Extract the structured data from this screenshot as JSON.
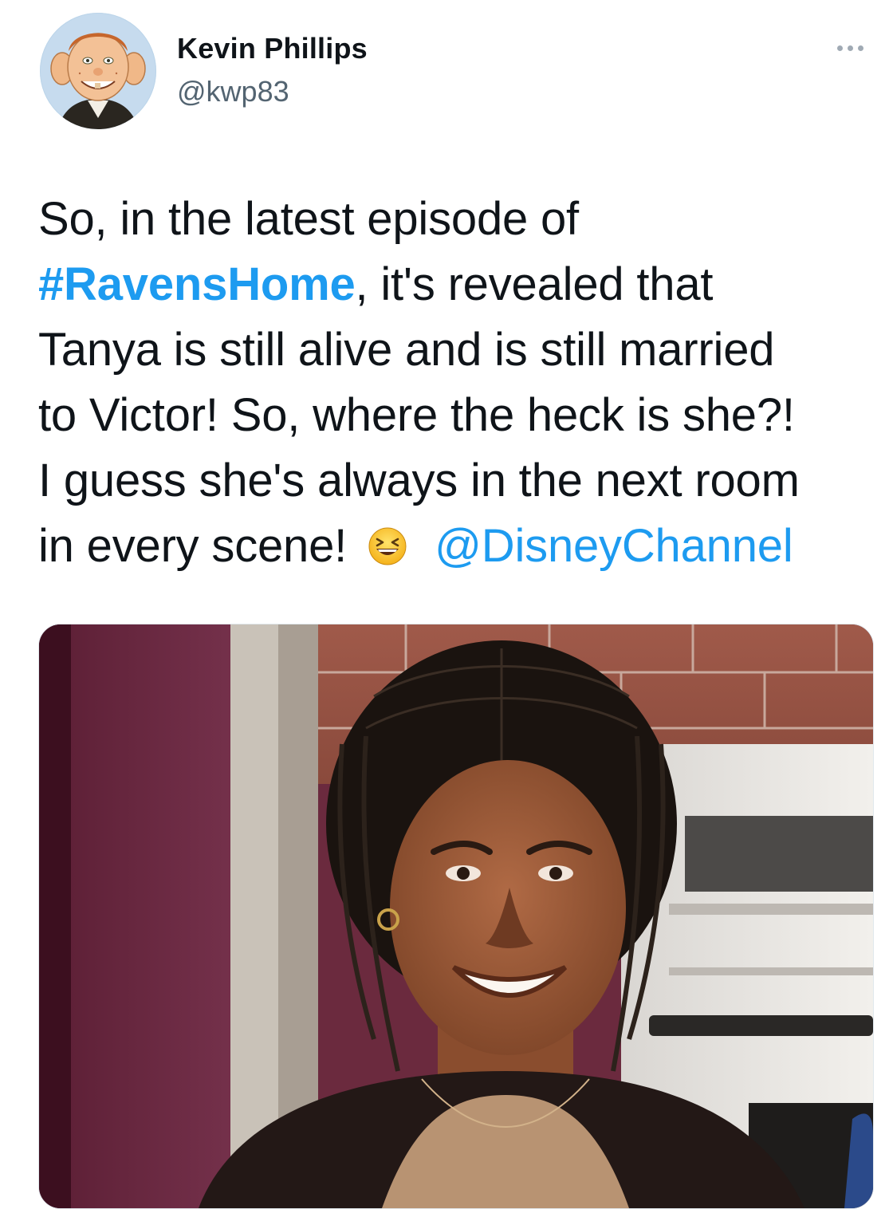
{
  "author": {
    "display_name": "Kevin Phillips",
    "handle": "@kwp83"
  },
  "tweet": {
    "lines": [
      [
        "So, in the latest episode of"
      ],
      [
        "#RavensHome",
        ", it's revealed that"
      ],
      [
        "Tanya is still alive and is still married"
      ],
      [
        "to Victor!  So, where the heck is she?!"
      ],
      [
        "I guess she's always in the next room"
      ],
      [
        "in every scene!",
        "@DisneyChannel"
      ]
    ],
    "hashtag": "#RavensHome",
    "mention": "@DisneyChannel",
    "emoji": "grinning-squinting-face"
  },
  "colors": {
    "link": "#1d9bf0",
    "text": "#0f1419",
    "secondary": "#536471"
  },
  "icons": {
    "more": "more-horizontal-icon"
  }
}
